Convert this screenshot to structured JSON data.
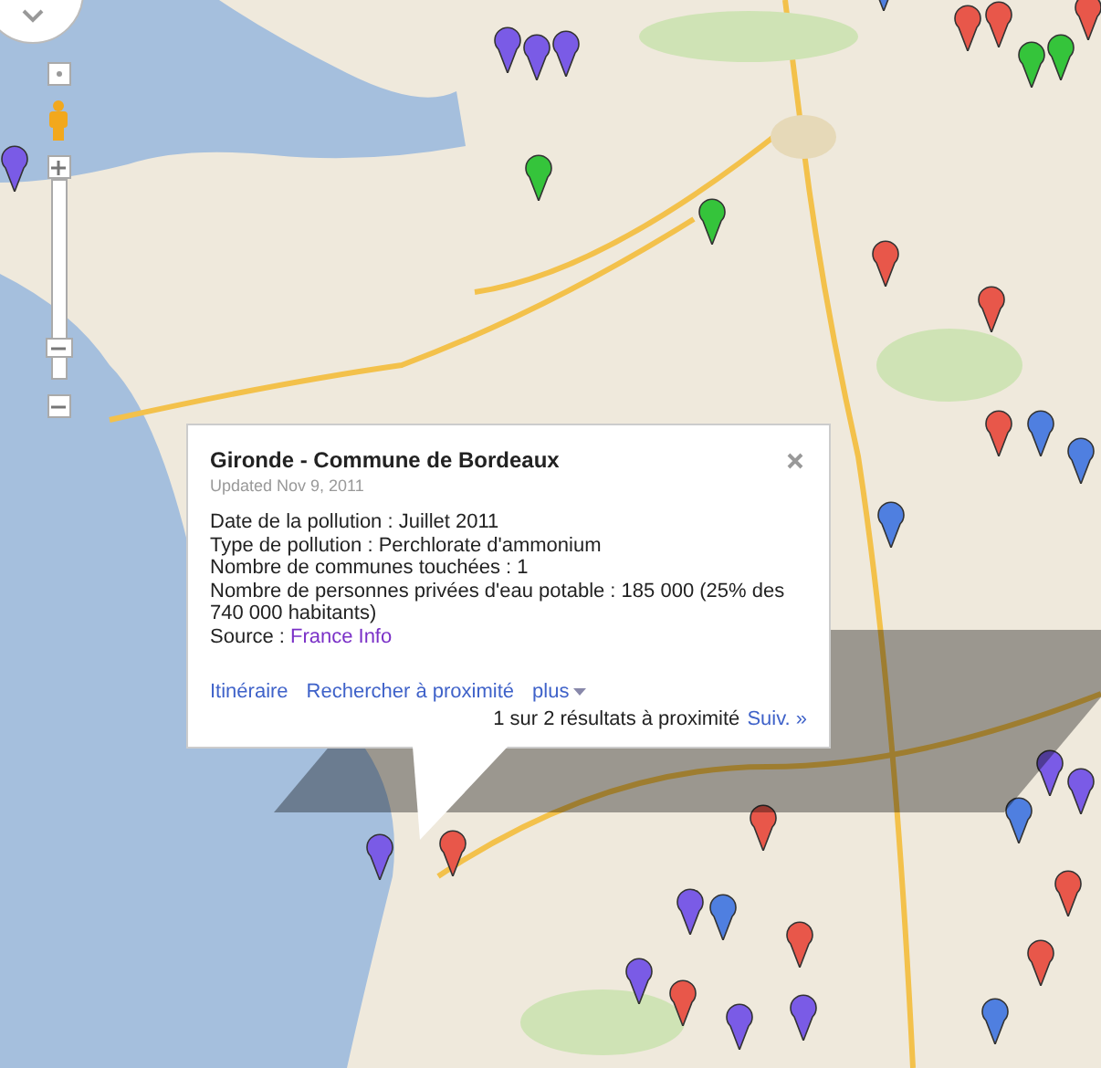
{
  "map": {
    "markers": [
      {
        "color": "#7a5be6"
      },
      {
        "color": "#7a5be6"
      },
      {
        "color": "#7a5be6"
      },
      {
        "color": "#7a5be6"
      },
      {
        "color": "#7a5be6"
      },
      {
        "color": "#7a5be6"
      },
      {
        "color": "#7a5be6"
      },
      {
        "color": "#7a5be6"
      },
      {
        "color": "#7a5be6"
      },
      {
        "color": "#7a5be6"
      },
      {
        "color": "#7a5be6"
      },
      {
        "color": "#4f7fe0"
      },
      {
        "color": "#4f7fe0"
      },
      {
        "color": "#4f7fe0"
      },
      {
        "color": "#4f7fe0"
      },
      {
        "color": "#4f7fe0"
      },
      {
        "color": "#4f7fe0"
      },
      {
        "color": "#4f7fe0"
      },
      {
        "color": "#35c43b"
      },
      {
        "color": "#35c43b"
      },
      {
        "color": "#35c43b"
      },
      {
        "color": "#35c43b"
      },
      {
        "color": "#e8574a"
      },
      {
        "color": "#e8574a"
      },
      {
        "color": "#e8574a"
      },
      {
        "color": "#e8574a"
      },
      {
        "color": "#e8574a"
      },
      {
        "color": "#e8574a"
      },
      {
        "color": "#e8574a"
      },
      {
        "color": "#e8574a"
      },
      {
        "color": "#e8574a"
      },
      {
        "color": "#e8574a"
      },
      {
        "color": "#e8574a"
      },
      {
        "color": "#e8574a"
      }
    ]
  },
  "info_window": {
    "title": "Gironde - Commune de Bordeaux",
    "updated": "Updated Nov 9, 2011",
    "details": [
      "Date de la pollution : Juillet 2011",
      "Type de pollution : Perchlorate d'ammonium",
      "Nombre de communes touchées : 1",
      "Nombre de personnes privées d'eau potable : 185 000 (25% des 740 000 habitants)"
    ],
    "source_label": "Source :",
    "source_link": "France Info",
    "actions": [
      "Itinéraire",
      "Rechercher à proximité",
      "plus"
    ],
    "results": "1 sur 2 résultats à proximité",
    "next": "Suiv. »"
  }
}
